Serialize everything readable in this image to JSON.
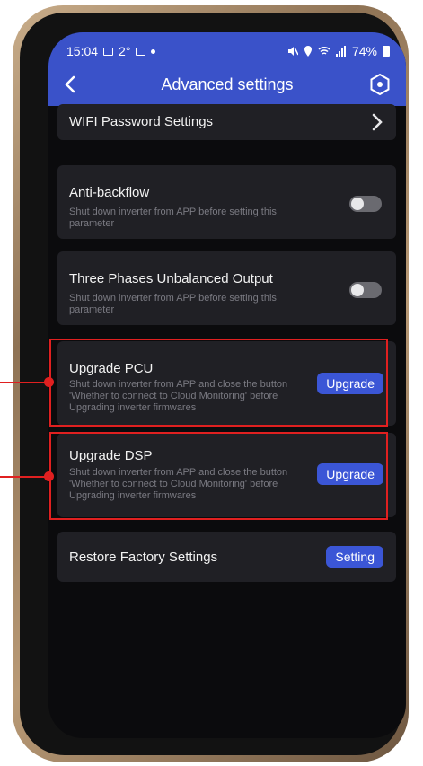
{
  "status": {
    "time": "15:04",
    "temp": "2°",
    "battery": "74%"
  },
  "header": {
    "title": "Advanced settings"
  },
  "items": {
    "wifi": {
      "label": "WIFI Password Settings"
    },
    "antibackflow": {
      "label": "Anti-backflow",
      "desc": "Shut down inverter from APP before setting this parameter",
      "toggle_on": false
    },
    "three_phase": {
      "label": "Three Phases Unbalanced Output",
      "desc": "Shut down inverter from APP before setting this parameter",
      "toggle_on": false
    },
    "upgrade_pcu": {
      "label": "Upgrade PCU",
      "desc": "Shut down inverter from APP and close the button 'Whether to connect to Cloud Monitoring' before Upgrading inverter firmwares",
      "button": "Upgrade"
    },
    "upgrade_dsp": {
      "label": "Upgrade DSP",
      "desc": "Shut down inverter from APP and close the button 'Whether to connect to Cloud Monitoring' before Upgrading inverter firmwares",
      "button": "Upgrade"
    },
    "restore": {
      "label": "Restore Factory Settings",
      "button": "Setting"
    }
  },
  "colors": {
    "header_bg": "#3a52c9",
    "button_bg": "#3b56d6",
    "highlight": "#e02020"
  }
}
